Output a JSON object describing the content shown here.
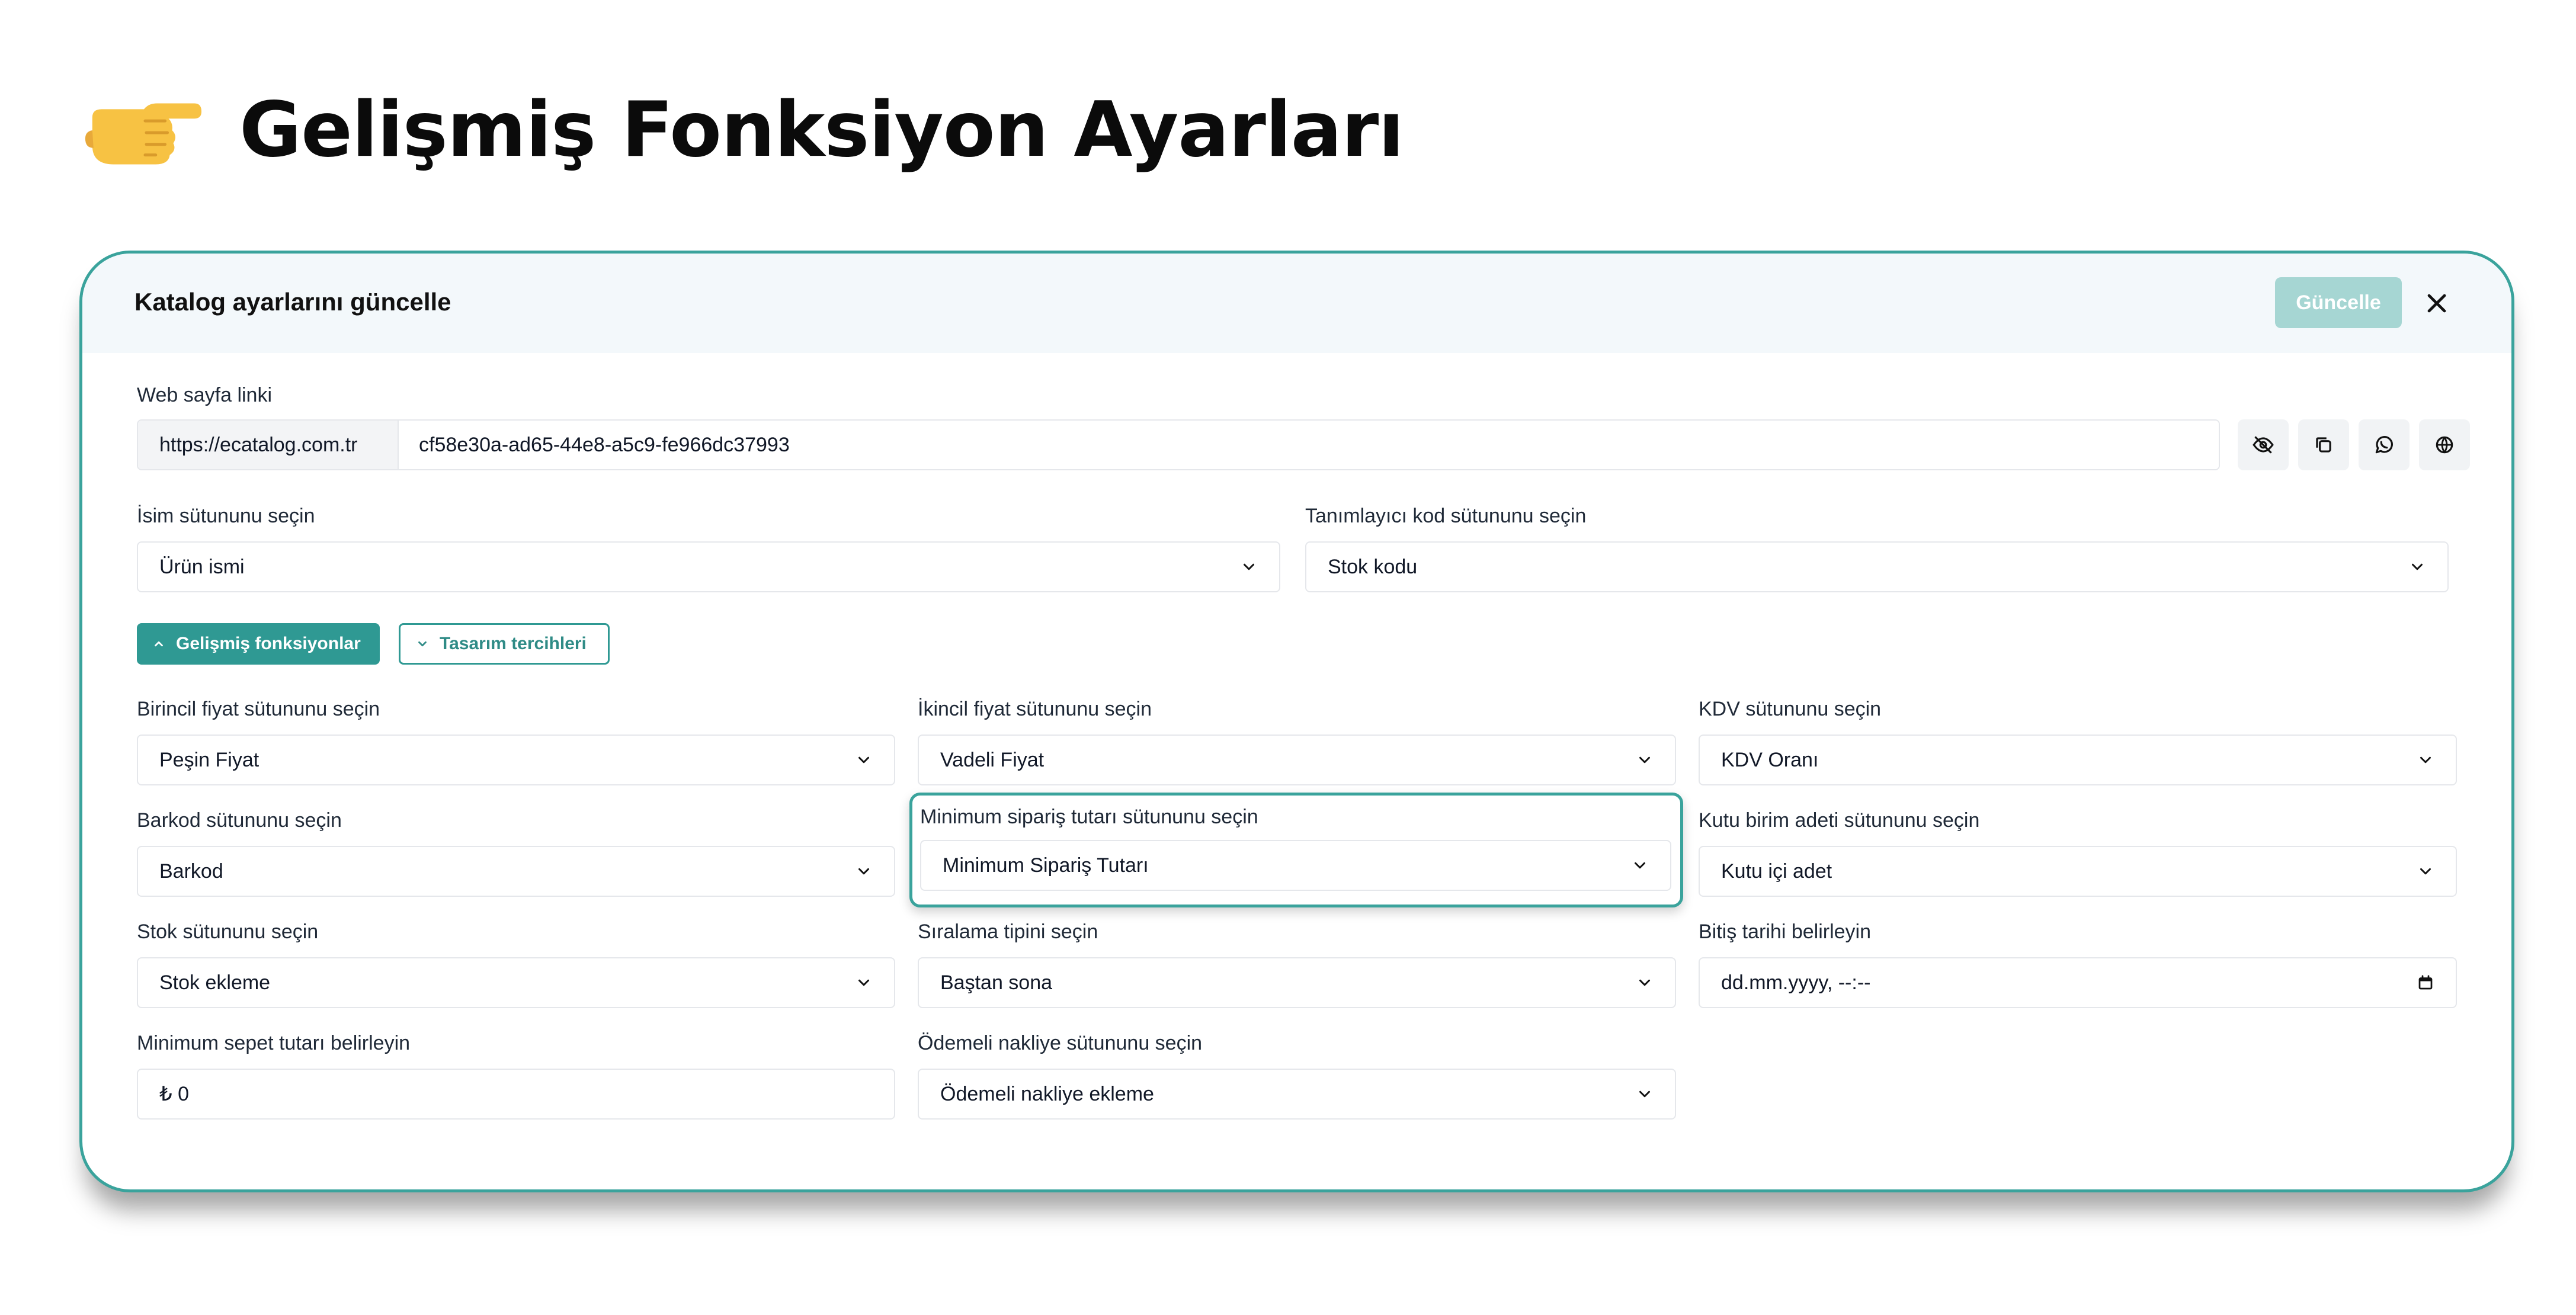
{
  "page": {
    "title": "Gelişmiş Fonksiyon Ayarları",
    "hand_icon": "backhand-index-pointing-right-emoji"
  },
  "modal": {
    "title": "Katalog ayarlarını güncelle",
    "update_label": "Güncelle",
    "accent_color": "#2f9993"
  },
  "web_link": {
    "label": "Web sayfa linki",
    "prefix": "https://ecatalog.com.tr",
    "value": "cf58e30a-ad65-44e8-a5c9-fe966dc37993",
    "actions": [
      "eye-off-icon",
      "copy-icon",
      "whatsapp-icon",
      "globe-icon"
    ]
  },
  "name_column": {
    "label": "İsim sütununu seçin",
    "value": "Ürün ismi"
  },
  "code_column": {
    "label": "Tanımlayıcı kod sütununu seçin",
    "value": "Stok kodu"
  },
  "toggles": {
    "advanced": "Gelişmiş fonksiyonlar",
    "design": "Tasarım tercihleri"
  },
  "fields": {
    "primary_price": {
      "label": "Birincil fiyat sütununu seçin",
      "value": "Peşin Fiyat"
    },
    "secondary_price": {
      "label": "İkincil fiyat sütununu seçin",
      "value": "Vadeli Fiyat"
    },
    "vat": {
      "label": "KDV sütununu seçin",
      "value": "KDV Oranı"
    },
    "barcode": {
      "label": "Barkod sütununu seçin",
      "value": "Barkod"
    },
    "min_order": {
      "label": "Minimum sipariş tutarı sütununu seçin",
      "value": "Minimum Sipariş Tutarı"
    },
    "box_unit": {
      "label": "Kutu birim adeti sütununu seçin",
      "value": "Kutu içi adet"
    },
    "stock": {
      "label": "Stok sütununu seçin",
      "value": "Stok ekleme"
    },
    "sort": {
      "label": "Sıralama tipini seçin",
      "value": "Baştan sona"
    },
    "end_date": {
      "label": "Bitiş tarihi belirleyin",
      "value": "dd.mm.yyyy, --:--"
    },
    "min_basket": {
      "label": "Minimum sepet tutarı belirleyin",
      "placeholder": "₺ 0"
    },
    "paid_shipping": {
      "label": "Ödemeli nakliye sütununu seçin",
      "value": "Ödemeli nakliye ekleme"
    }
  }
}
